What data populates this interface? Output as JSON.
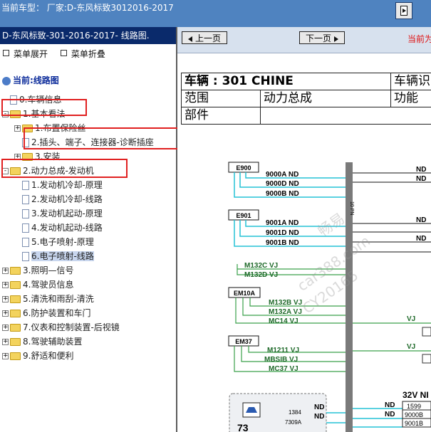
{
  "topbar": {
    "title": "当前车型：   厂家:D-东风标致3012016-2017"
  },
  "left": {
    "header": "D-东风标致-301-2016-2017- 线路图.",
    "expand_label": "菜单展开",
    "collapse_label": "菜单折叠",
    "root_label": "当前:线路图",
    "tree": [
      {
        "label": "0.车辆信息",
        "type": "doc"
      },
      {
        "label": "1.基本看法",
        "type": "folder",
        "open": "-"
      },
      {
        "label": "1.布置保险丝",
        "type": "folder",
        "open": "+"
      },
      {
        "label": "2.插头、端子、连接器-诊断插座",
        "type": "doc"
      },
      {
        "label": "3.安装",
        "type": "folder",
        "open": "+"
      },
      {
        "label": "2.动力总成-发动机",
        "type": "folder",
        "open": "-"
      },
      {
        "label": "1.发动机冷却-原理",
        "type": "doc"
      },
      {
        "label": "2.发动机冷却-线路",
        "type": "doc"
      },
      {
        "label": "3.发动机起动-原理",
        "type": "doc"
      },
      {
        "label": "4.发动机起动-线路",
        "type": "doc"
      },
      {
        "label": "5.电子喷射-原理",
        "type": "doc"
      },
      {
        "label": "6.电子喷射-线路",
        "type": "doc"
      },
      {
        "label": "3.照明—信号",
        "type": "folder",
        "open": "+"
      },
      {
        "label": "4.驾驶员信息",
        "type": "folder",
        "open": "+"
      },
      {
        "label": "5.清洗和雨刮-清洗",
        "type": "folder",
        "open": "+"
      },
      {
        "label": "6.防护装置和车门",
        "type": "folder",
        "open": "+"
      },
      {
        "label": "7.仪表和控制装置-后视镜",
        "type": "folder",
        "open": "+"
      },
      {
        "label": "8.驾驶辅助装置",
        "type": "folder",
        "open": "+"
      },
      {
        "label": "9.舒适和便利",
        "type": "folder",
        "open": "+"
      }
    ]
  },
  "right": {
    "prev_label": "上一页",
    "next_label": "下一页",
    "current_tag": "当前为",
    "table": {
      "vehicle": "车辆 : 301 CHINE",
      "vehicle_id": "车辆识",
      "scope_label": "范围",
      "scope_value": "动力总成",
      "function_label": "功能",
      "part_label": "部件"
    },
    "diagram": {
      "connectors": [
        "E900",
        "E901",
        "EM10A",
        "EM37"
      ],
      "wires_e900": [
        "9000A ND",
        "9000D ND",
        "9000B ND"
      ],
      "wires_e901": [
        "9001A ND",
        "9001D ND",
        "9001B ND"
      ],
      "wires_mid": [
        "M132C VJ",
        "M132D VJ"
      ],
      "wires_em10a": [
        "M132B VJ",
        "M132A VJ",
        "MC14 VJ"
      ],
      "wires_em37": [
        "M1211 VJ",
        "MBSIB VJ",
        "MC37 VJ"
      ],
      "bus_label": "10 PN",
      "vj1": "VJ",
      "vj2": "VJ",
      "right_nd": [
        "ND",
        "ND",
        "ND",
        "ND"
      ],
      "bottom": {
        "label_32v": "32V NI",
        "nd_list": [
          "ND",
          "ND",
          "ND",
          "ND"
        ],
        "codes": [
          "1599",
          "9000B",
          "9001B"
        ],
        "pins": [
          "1384",
          "7309A"
        ],
        "comp": "73"
      },
      "watermarks": [
        "畅易",
        "car388.com",
        "CY20165"
      ]
    }
  }
}
